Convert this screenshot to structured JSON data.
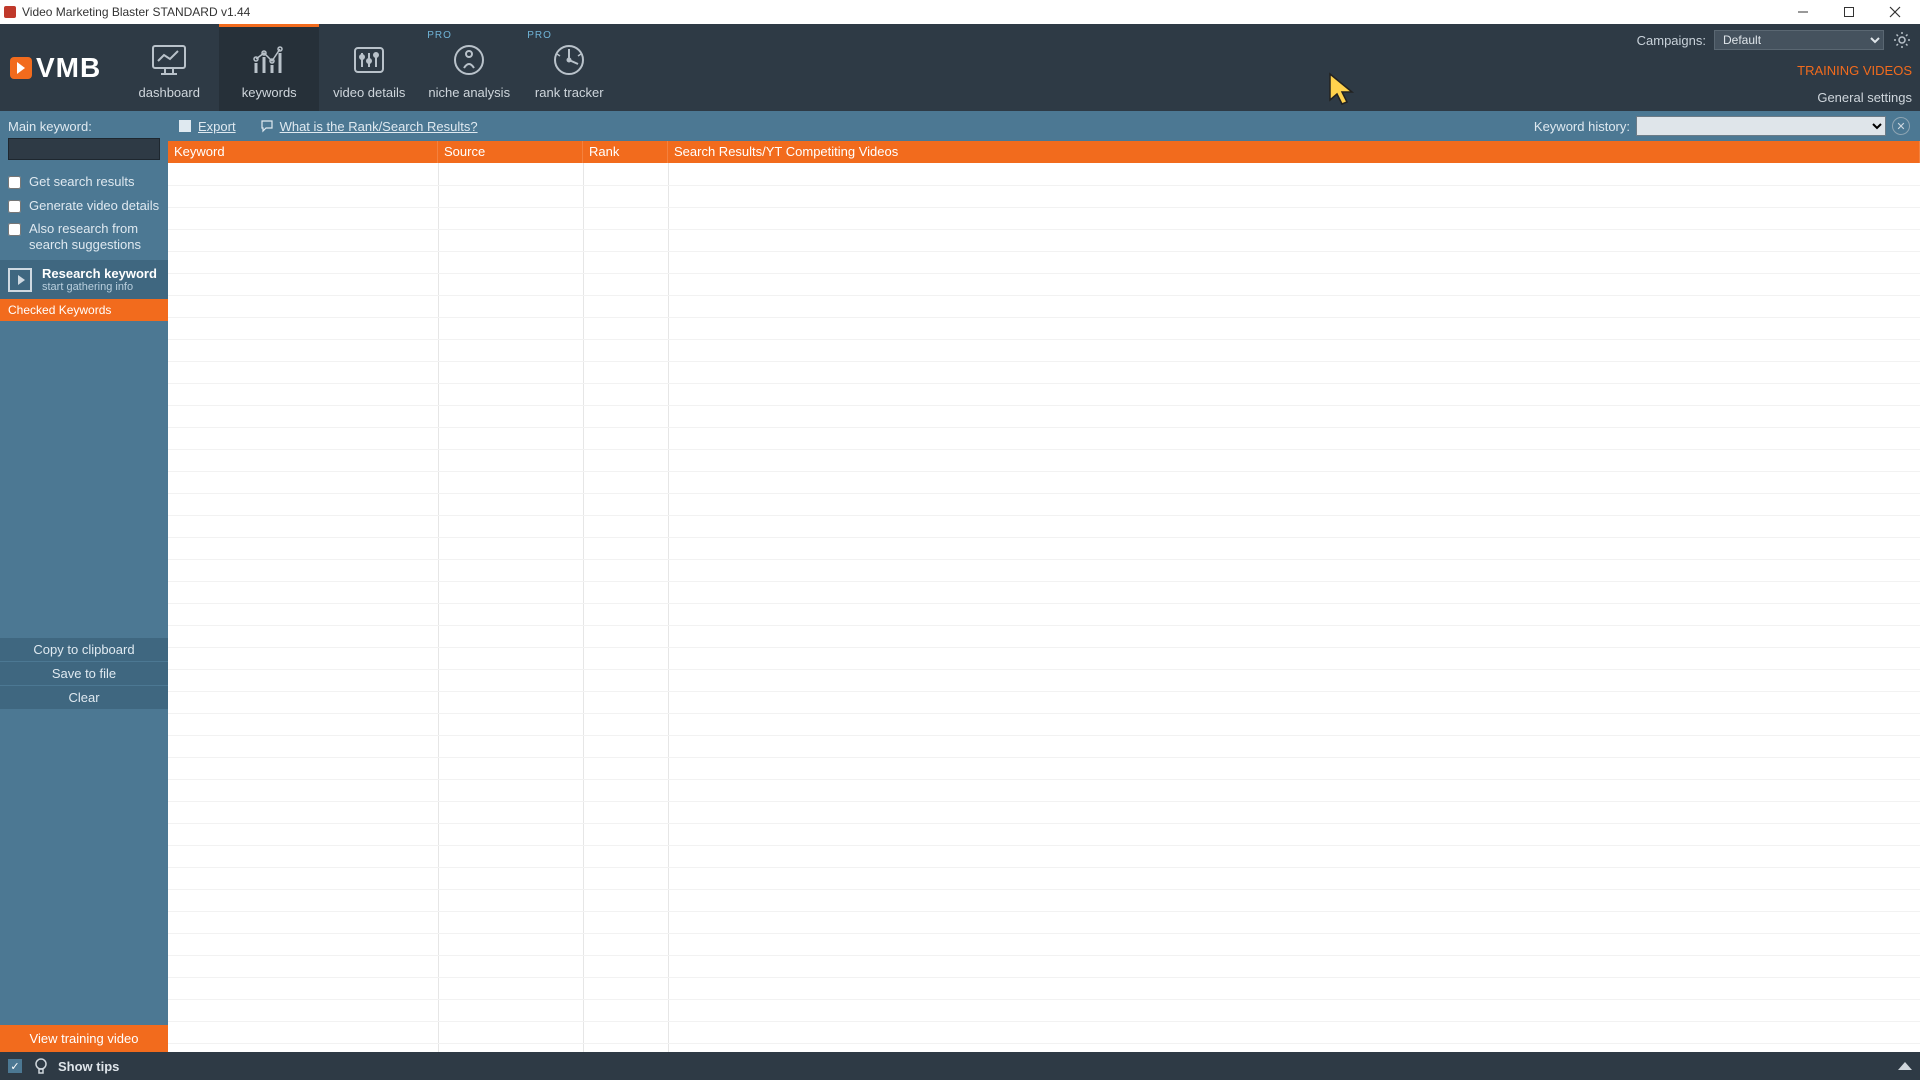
{
  "app": {
    "title": "Video Marketing Blaster STANDARD v1.44",
    "logo_text": "VMB"
  },
  "nav": {
    "tabs": [
      {
        "label": "dashboard",
        "pro": false
      },
      {
        "label": "keywords",
        "pro": false
      },
      {
        "label": "video details",
        "pro": false
      },
      {
        "label": "niche analysis",
        "pro": true
      },
      {
        "label": "rank tracker",
        "pro": true
      }
    ],
    "campaigns_label": "Campaigns:",
    "campaigns_value": "Default",
    "training_videos": "TRAINING VIDEOS",
    "general_settings": "General settings"
  },
  "toolbar": {
    "export_label": "Export",
    "whatis_label": "What is the Rank/Search Results?",
    "history_label": "Keyword history:",
    "history_value": ""
  },
  "sidebar": {
    "main_keyword_label": "Main keyword:",
    "main_keyword_value": "",
    "cb_get_search": "Get search results",
    "cb_gen_details": "Generate video details",
    "cb_also_research": "Also research from search suggestions",
    "research_title": "Research keyword",
    "research_sub": "start gathering info",
    "checked_header": "Checked Keywords",
    "btn_copy": "Copy to clipboard",
    "btn_save": "Save to file",
    "btn_clear": "Clear",
    "btn_training": "View training video"
  },
  "table": {
    "columns": {
      "keyword": "Keyword",
      "source": "Source",
      "rank": "Rank",
      "results": "Search Results/YT Competiting Videos"
    },
    "rows": []
  },
  "statusbar": {
    "show_tips": "Show tips"
  },
  "pro_tag": "PRO"
}
